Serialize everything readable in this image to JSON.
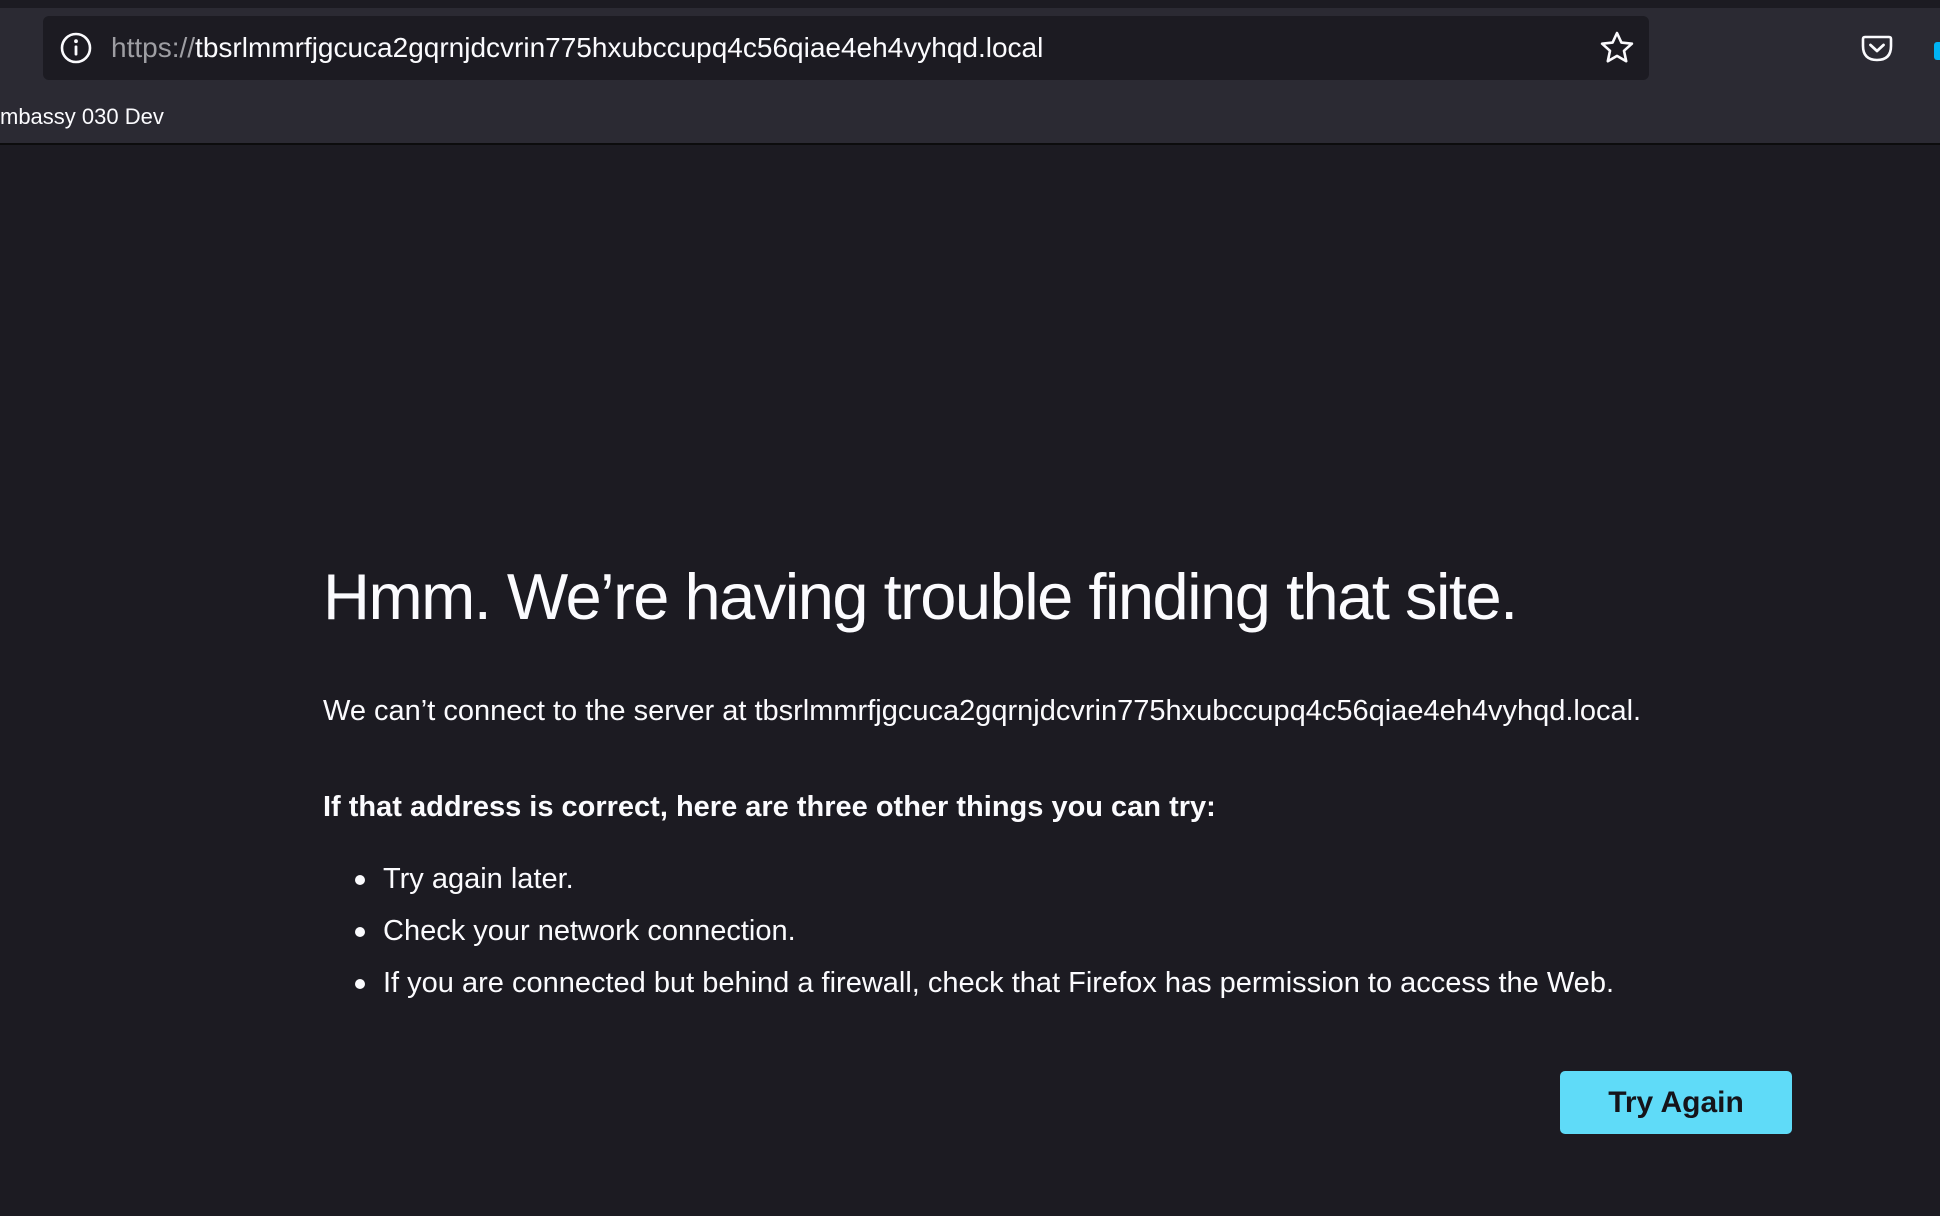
{
  "toolbar": {
    "url_scheme": "https://",
    "url_host": "tbsrlmmrfjgcuca2gqrnjdcvrin775hxubccupq4c56qiae4eh4vyhqd.local",
    "bookmark_label": "mbassy 030 Dev"
  },
  "error": {
    "title": "Hmm. We’re having trouble finding that site.",
    "description": "We can’t connect to the server at tbsrlmmrfjgcuca2gqrnjdcvrin775hxubccupq4c56qiae4eh4vyhqd.local.",
    "suggestions_heading": "If that address is correct, here are three other things you can try:",
    "suggestions": [
      "Try again later.",
      "Check your network connection.",
      "If you are connected but behind a firewall, check that Firefox has permission to access the Web."
    ],
    "button_label": "Try Again"
  },
  "icons": {
    "site_info": "info-icon",
    "bookmark_star": "star-icon",
    "pocket": "pocket-icon"
  },
  "colors": {
    "page_background": "#1c1b22",
    "toolbar_background": "#2b2a33",
    "button_accent": "#5fdbf8"
  }
}
